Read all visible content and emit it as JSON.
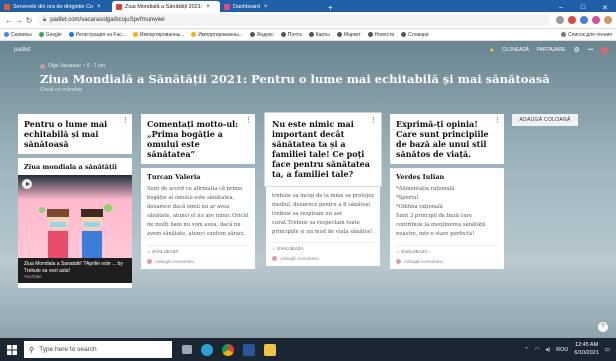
{
  "browser": {
    "tabs": [
      {
        "title": "Serverele din ora de dirigintie Co",
        "fav": "#e65c2b",
        "active": false
      },
      {
        "title": "Ziua Mondială a Sănătății 2021:",
        "fav": "#d13f3f",
        "active": true
      },
      {
        "title": "Dashboard",
        "fav": "#e24b79",
        "active": false
      }
    ],
    "new_tab": "+",
    "url": "padlet.com/vacarasolga/bcojuSpvfmunwiwi",
    "bookmarks": [
      {
        "label": "Сервисы",
        "color": "#4285f4"
      },
      {
        "label": "Google",
        "color": "#34a853"
      },
      {
        "label": "Регистрация на Fac...",
        "color": "#1877f2"
      },
      {
        "label": "Импортированны...",
        "color": "#f4b400"
      },
      {
        "label": "Импортированны...",
        "color": "#f4b400"
      },
      {
        "label": "Яндекс",
        "color": "#555"
      },
      {
        "label": "Почта",
        "color": "#555"
      },
      {
        "label": "Карты",
        "color": "#555"
      },
      {
        "label": "Маркет",
        "color": "#555"
      },
      {
        "label": "Новости",
        "color": "#555"
      },
      {
        "label": "Словари",
        "color": "#555"
      }
    ],
    "bookmarks_right": "Список для чтения"
  },
  "padlet": {
    "logo_text": "padlet",
    "top_actions": {
      "clone": "CLONEAZĂ",
      "share": "PARTAJARE"
    },
    "author": "Olga Vacarasu",
    "author_meta": "• 5 · 1 lun",
    "title": "Ziua Mondială a Sănătății 2021: Pentru o lume mai echitabilă și mai sănătoasă",
    "subtitle": "Creat cu mândrie",
    "add_column": "ADAUGĂ COLOANĂ",
    "help": "?",
    "columns": [
      {
        "header": "Pentru o lume mai echitabilă și mai sănătoasă",
        "card": {
          "title": "Ziua mondiala a sănătății",
          "video_caption": "Ziua Mondiala a Sanatatii! ?Aprilie este ... by Trebuie sa vezi asta!",
          "video_source": "YouTube"
        }
      },
      {
        "header": "Comentați motto-ul: „Prima bogăție a omului este sănătatea”",
        "card": {
          "title": "Țurcan Valeria",
          "body": "Sunt de acord cu afirmația că prima bogăție al omului este sănătatea, deoarece dacă omul nu ar avea sănătate, atunci el nu are nimic.Oricât de mulți bani nu vom avea, dacă nu avem sănătate, atunci suntem săraci.",
          "rate": "EVALUEAZĂ",
          "comment": "Adaugă comentariu"
        }
      },
      {
        "header": "Nu este nimic mai important decât sănătatea ta și a familiei tale! Ce poți face pentru sănătatea ta, a familiei tale?",
        "card": {
          "body": "trebuie sa incep de la mine sa protejez mediul, deoarece pentru a fi sănătoși trebuie sa respiram un aer curat.Trebuie sa respectam toate principiile și un mod de viața sănătos!",
          "rate": "EVALUEAZĂ",
          "comment": "Adaugă comentariu"
        }
      },
      {
        "header": "Exprimă-ți opinia! Care sunt principiile de bază ale unui stil sănătos de viață.",
        "card": {
          "title": "Verdeș Iulian",
          "body_lines": [
            "*Alimentația rațională",
            "*Sportul",
            "*Odihna rațională",
            "Sunt 3 principii de bază care contribuie la menținerea sănătății noastre, intr-o stare perfecta!"
          ],
          "rate": "EVALUEAZĂ",
          "comment": "Adaugă comentariu"
        }
      }
    ]
  },
  "taskbar": {
    "search_placeholder": "Type here to search",
    "tray_lang": "ROU",
    "time": "12:45 AM",
    "date": "6/10/2021",
    "icons": [
      {
        "name": "task-view-icon",
        "color": "#9aa7b5"
      },
      {
        "name": "edge-icon",
        "color": "#2ea0d8"
      },
      {
        "name": "chrome-icon",
        "color": "#e8c02f"
      },
      {
        "name": "word-icon",
        "color": "#2b579a"
      },
      {
        "name": "file-explorer-icon",
        "color": "#f3c248"
      }
    ]
  }
}
